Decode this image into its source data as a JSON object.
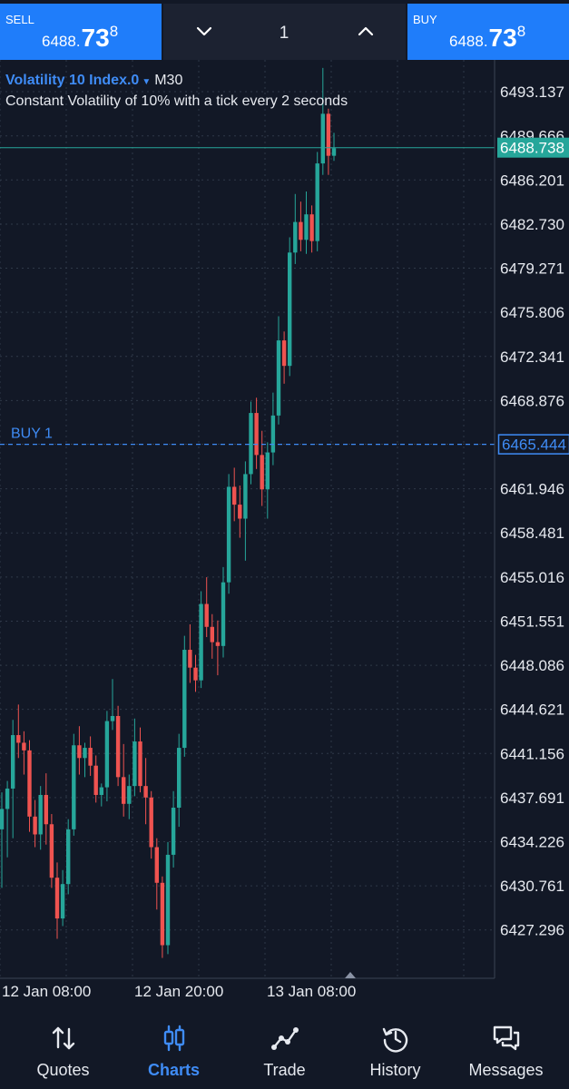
{
  "trade_bar": {
    "sell": {
      "label": "SELL",
      "price_small": "6488.",
      "price_large": "73",
      "price_super": "8"
    },
    "buy": {
      "label": "BUY",
      "price_small": "6488.",
      "price_large": "73",
      "price_super": "8"
    },
    "volume": "1"
  },
  "chart_header": {
    "symbol": "Volatility 10 Index.0",
    "timeframe": "M30",
    "description": "Constant Volatility of 10% with a tick every 2 seconds"
  },
  "price_axis": {
    "ticks": [
      "6493.137",
      "6489.666",
      "6486.201",
      "6482.730",
      "6479.271",
      "6475.806",
      "6472.341",
      "6468.876",
      "6465.444",
      "6461.946",
      "6458.481",
      "6455.016",
      "6451.551",
      "6448.086",
      "6444.621",
      "6441.156",
      "6437.691",
      "6434.226",
      "6430.761",
      "6427.296"
    ],
    "current_price_label": "6488.738",
    "order_price_label": "6465.444"
  },
  "order_line": {
    "label": "BUY 1",
    "price": 6465.44
  },
  "current_price": 6488.74,
  "time_axis": {
    "labels": [
      "12 Jan 08:00",
      "12 Jan 20:00",
      "13 Jan 08:00"
    ]
  },
  "colors": {
    "background": "#121826",
    "bullish": "#26a69a",
    "bearish": "#ef5350",
    "accent": "#1f7dfa",
    "grid": "#2f3848"
  },
  "chart_data": {
    "type": "candlestick",
    "timeframe": "M30",
    "ylim": [
      6424.5,
      6496.0
    ],
    "x_labels": [
      "12 Jan 08:00",
      "12 Jan 20:00",
      "13 Jan 08:00"
    ],
    "candles": [
      {
        "o": 6435.2,
        "h": 6438.1,
        "l": 6430.6,
        "c": 6436.8
      },
      {
        "o": 6436.8,
        "h": 6439.0,
        "l": 6433.0,
        "c": 6438.4
      },
      {
        "o": 6438.4,
        "h": 6443.8,
        "l": 6434.5,
        "c": 6442.6
      },
      {
        "o": 6442.6,
        "h": 6445.0,
        "l": 6440.8,
        "c": 6442.0
      },
      {
        "o": 6442.0,
        "h": 6442.9,
        "l": 6439.5,
        "c": 6441.4
      },
      {
        "o": 6441.4,
        "h": 6442.2,
        "l": 6435.0,
        "c": 6436.2
      },
      {
        "o": 6436.2,
        "h": 6437.5,
        "l": 6433.8,
        "c": 6434.8
      },
      {
        "o": 6434.8,
        "h": 6438.6,
        "l": 6433.6,
        "c": 6437.9
      },
      {
        "o": 6437.9,
        "h": 6439.6,
        "l": 6434.0,
        "c": 6435.6
      },
      {
        "o": 6435.6,
        "h": 6436.4,
        "l": 6430.6,
        "c": 6431.4
      },
      {
        "o": 6431.4,
        "h": 6432.6,
        "l": 6426.6,
        "c": 6428.2
      },
      {
        "o": 6428.2,
        "h": 6432.0,
        "l": 6427.6,
        "c": 6430.9
      },
      {
        "o": 6430.9,
        "h": 6436.0,
        "l": 6430.1,
        "c": 6435.2
      },
      {
        "o": 6435.2,
        "h": 6442.7,
        "l": 6434.7,
        "c": 6441.8
      },
      {
        "o": 6441.8,
        "h": 6443.3,
        "l": 6439.5,
        "c": 6440.8
      },
      {
        "o": 6440.8,
        "h": 6442.0,
        "l": 6439.3,
        "c": 6441.6
      },
      {
        "o": 6441.6,
        "h": 6442.5,
        "l": 6439.4,
        "c": 6440.2
      },
      {
        "o": 6440.2,
        "h": 6441.0,
        "l": 6437.3,
        "c": 6437.9
      },
      {
        "o": 6437.9,
        "h": 6438.8,
        "l": 6437.0,
        "c": 6438.5
      },
      {
        "o": 6438.5,
        "h": 6444.5,
        "l": 6437.4,
        "c": 6443.7
      },
      {
        "o": 6443.7,
        "h": 6447.0,
        "l": 6443.0,
        "c": 6444.1
      },
      {
        "o": 6444.1,
        "h": 6444.9,
        "l": 6438.6,
        "c": 6439.3
      },
      {
        "o": 6439.3,
        "h": 6441.9,
        "l": 6436.2,
        "c": 6437.2
      },
      {
        "o": 6437.2,
        "h": 6439.5,
        "l": 6436.0,
        "c": 6438.6
      },
      {
        "o": 6438.6,
        "h": 6443.9,
        "l": 6437.8,
        "c": 6442.1
      },
      {
        "o": 6442.1,
        "h": 6443.2,
        "l": 6438.1,
        "c": 6438.6
      },
      {
        "o": 6438.6,
        "h": 6440.8,
        "l": 6435.6,
        "c": 6437.7
      },
      {
        "o": 6437.7,
        "h": 6438.2,
        "l": 6432.9,
        "c": 6433.8
      },
      {
        "o": 6433.8,
        "h": 6434.5,
        "l": 6428.9,
        "c": 6431.0
      },
      {
        "o": 6431.0,
        "h": 6431.5,
        "l": 6425.1,
        "c": 6426.1
      },
      {
        "o": 6426.1,
        "h": 6434.2,
        "l": 6425.4,
        "c": 6433.2
      },
      {
        "o": 6433.2,
        "h": 6438.2,
        "l": 6432.2,
        "c": 6436.9
      },
      {
        "o": 6436.9,
        "h": 6442.7,
        "l": 6435.4,
        "c": 6441.6
      },
      {
        "o": 6441.6,
        "h": 6450.4,
        "l": 6440.9,
        "c": 6449.3
      },
      {
        "o": 6449.3,
        "h": 6451.3,
        "l": 6446.7,
        "c": 6447.9
      },
      {
        "o": 6447.9,
        "h": 6448.9,
        "l": 6446.0,
        "c": 6446.9
      },
      {
        "o": 6446.9,
        "h": 6453.9,
        "l": 6446.3,
        "c": 6452.9
      },
      {
        "o": 6452.9,
        "h": 6455.0,
        "l": 6450.3,
        "c": 6451.1
      },
      {
        "o": 6451.1,
        "h": 6452.1,
        "l": 6448.6,
        "c": 6449.9
      },
      {
        "o": 6449.9,
        "h": 6451.6,
        "l": 6447.3,
        "c": 6449.6
      },
      {
        "o": 6449.6,
        "h": 6455.8,
        "l": 6448.7,
        "c": 6454.6
      },
      {
        "o": 6454.6,
        "h": 6463.1,
        "l": 6453.7,
        "c": 6462.1
      },
      {
        "o": 6462.1,
        "h": 6463.6,
        "l": 6459.4,
        "c": 6460.7
      },
      {
        "o": 6460.7,
        "h": 6462.2,
        "l": 6458.1,
        "c": 6459.6
      },
      {
        "o": 6459.6,
        "h": 6464.1,
        "l": 6456.3,
        "c": 6463.1
      },
      {
        "o": 6463.1,
        "h": 6468.8,
        "l": 6462.3,
        "c": 6467.9
      },
      {
        "o": 6467.9,
        "h": 6469.1,
        "l": 6463.5,
        "c": 6464.6
      },
      {
        "o": 6464.6,
        "h": 6466.5,
        "l": 6460.6,
        "c": 6461.9
      },
      {
        "o": 6461.9,
        "h": 6465.6,
        "l": 6459.6,
        "c": 6464.8
      },
      {
        "o": 6464.8,
        "h": 6469.5,
        "l": 6463.8,
        "c": 6467.7
      },
      {
        "o": 6467.7,
        "h": 6475.5,
        "l": 6467.0,
        "c": 6473.6
      },
      {
        "o": 6473.6,
        "h": 6474.3,
        "l": 6470.2,
        "c": 6471.6
      },
      {
        "o": 6471.6,
        "h": 6481.7,
        "l": 6470.8,
        "c": 6480.5
      },
      {
        "o": 6480.5,
        "h": 6485.1,
        "l": 6479.6,
        "c": 6482.9
      },
      {
        "o": 6482.9,
        "h": 6484.5,
        "l": 6480.6,
        "c": 6481.5
      },
      {
        "o": 6481.5,
        "h": 6485.3,
        "l": 6480.4,
        "c": 6483.5
      },
      {
        "o": 6483.5,
        "h": 6484.2,
        "l": 6480.5,
        "c": 6481.4
      },
      {
        "o": 6481.4,
        "h": 6488.4,
        "l": 6480.6,
        "c": 6487.5
      },
      {
        "o": 6487.5,
        "h": 6495.0,
        "l": 6486.6,
        "c": 6491.4
      },
      {
        "o": 6491.4,
        "h": 6491.8,
        "l": 6486.6,
        "c": 6488.1
      },
      {
        "o": 6488.1,
        "h": 6489.9,
        "l": 6487.7,
        "c": 6488.7
      }
    ]
  },
  "bottom_nav": [
    {
      "label": "Quotes",
      "icon": "quotes-arrows-icon",
      "active": false
    },
    {
      "label": "Charts",
      "icon": "candles-icon",
      "active": true
    },
    {
      "label": "Trade",
      "icon": "trend-line-icon",
      "active": false
    },
    {
      "label": "History",
      "icon": "history-clock-icon",
      "active": false
    },
    {
      "label": "Messages",
      "icon": "messages-icon",
      "active": false
    }
  ]
}
